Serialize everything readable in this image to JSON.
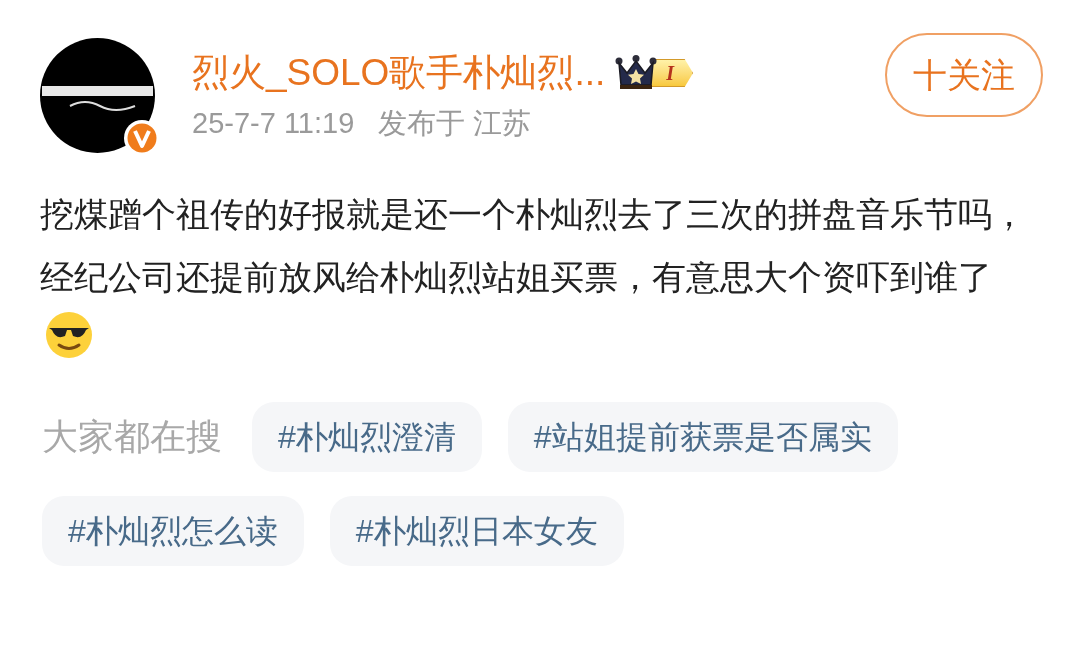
{
  "post": {
    "author": {
      "name": "烈火_SOLO歌手朴灿烈...",
      "verified": true,
      "member_badge": "I"
    },
    "follow_button": "十关注",
    "meta": {
      "time": "25-7-7 11:19",
      "location": "发布于 江苏"
    },
    "body": "挖煤蹭个祖传的好报就是还一个朴灿烈去了三次的拼盘音乐节吗，经纪公司还提前放风给朴灿烈站姐买票，有意思大个资吓到谁了"
  },
  "trending": {
    "label": "大家都在搜",
    "tags": [
      "#朴灿烈澄清",
      "#站姐提前获票是否属实",
      "#朴灿烈怎么读",
      "#朴灿烈日本女友"
    ]
  }
}
